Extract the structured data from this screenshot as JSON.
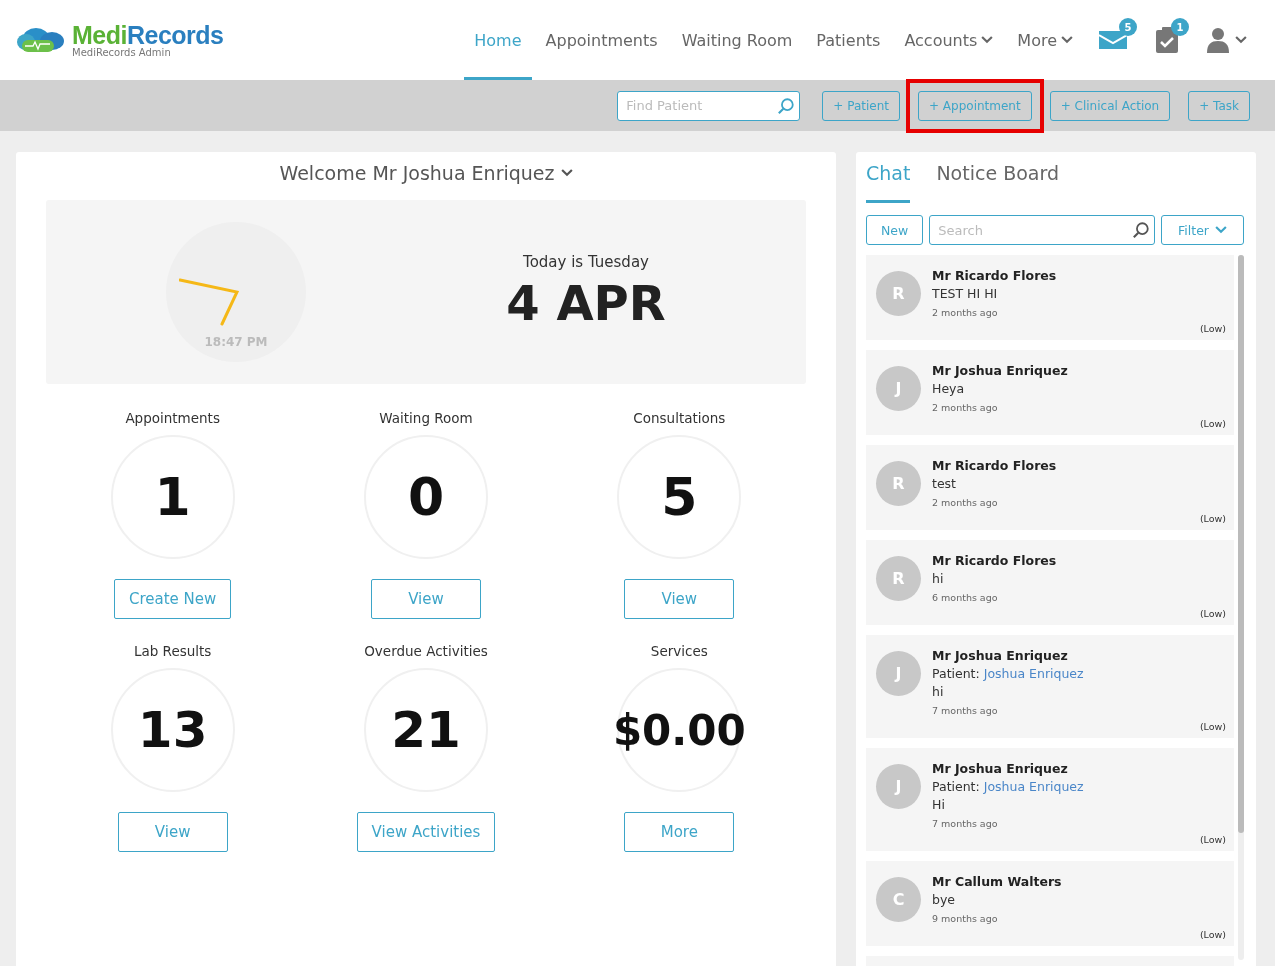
{
  "brand": {
    "name_first": "Medi",
    "name_second": "Records",
    "subtitle": "MediRecords Admin"
  },
  "nav": [
    {
      "label": "Home",
      "selected": true,
      "dropdown": false
    },
    {
      "label": "Appointments",
      "selected": false,
      "dropdown": false
    },
    {
      "label": "Waiting Room",
      "selected": false,
      "dropdown": false
    },
    {
      "label": "Patients",
      "selected": false,
      "dropdown": false
    },
    {
      "label": "Accounts",
      "selected": false,
      "dropdown": true
    },
    {
      "label": "More",
      "selected": false,
      "dropdown": true
    }
  ],
  "badges": {
    "messages": "5",
    "tasks": "1"
  },
  "toolbar": {
    "search": {
      "placeholder": "Find Patient"
    },
    "actions": [
      {
        "label": "+ Patient",
        "highlighted": false
      },
      {
        "label": "+ Appointment",
        "highlighted": true
      },
      {
        "label": "+ Clinical Action",
        "highlighted": false
      },
      {
        "label": "+ Task",
        "highlighted": false
      }
    ]
  },
  "welcome": {
    "title": "Welcome Mr Joshua Enriquez",
    "time": "18:47 PM",
    "day": "Today is Tuesday",
    "date": "4 APR"
  },
  "stats": [
    {
      "label": "Appointments",
      "value": "1",
      "button": "Create New"
    },
    {
      "label": "Waiting Room",
      "value": "0",
      "button": "View"
    },
    {
      "label": "Consultations",
      "value": "5",
      "button": "View"
    },
    {
      "label": "Lab Results",
      "value": "13",
      "button": "View"
    },
    {
      "label": "Overdue Activities",
      "value": "21",
      "button": "View Activities"
    },
    {
      "label": "Services",
      "value": "$0.00",
      "button": "More"
    }
  ],
  "side_tabs": [
    {
      "label": "Chat",
      "selected": true
    },
    {
      "label": "Notice Board",
      "selected": false
    }
  ],
  "chat_controls": {
    "new": "New",
    "search": {
      "placeholder": "Search"
    },
    "filter": "Filter"
  },
  "chats": [
    {
      "initial": "R",
      "name": "Mr Ricardo Flores",
      "message": "TEST HI HI",
      "time": "2 months ago",
      "priority": "(Low)"
    },
    {
      "initial": "J",
      "name": "Mr Joshua Enriquez",
      "message": "Heya",
      "time": "2 months ago",
      "priority": "(Low)"
    },
    {
      "initial": "R",
      "name": "Mr Ricardo Flores",
      "message": "test",
      "time": "2 months ago",
      "priority": "(Low)"
    },
    {
      "initial": "R",
      "name": "Mr Ricardo Flores",
      "message": "hi",
      "time": "6 months ago",
      "priority": "(Low)"
    },
    {
      "initial": "J",
      "name": "Mr Joshua Enriquez",
      "patient_label": "Patient:",
      "patient": "Joshua Enriquez",
      "message": "hi",
      "time": "7 months ago",
      "priority": "(Low)"
    },
    {
      "initial": "J",
      "name": "Mr Joshua Enriquez",
      "patient_label": "Patient:",
      "patient": "Joshua Enriquez",
      "message": "Hi",
      "time": "7 months ago",
      "priority": "(Low)"
    },
    {
      "initial": "C",
      "name": "Mr Callum Walters",
      "message": "bye",
      "time": "9 months ago",
      "priority": "(Low)"
    }
  ]
}
